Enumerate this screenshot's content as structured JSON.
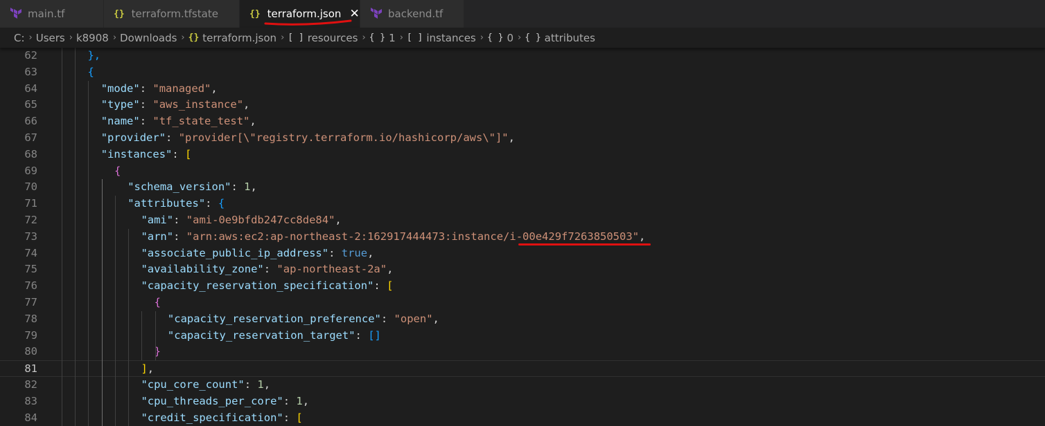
{
  "tabs": [
    {
      "label": "main.tf",
      "icon": "terraform-icon",
      "active": false
    },
    {
      "label": "terraform.tfstate",
      "icon": "json-braces-icon",
      "active": false
    },
    {
      "label": "terraform.json",
      "icon": "json-braces-icon",
      "active": true
    },
    {
      "label": "backend.tf",
      "icon": "terraform-icon",
      "active": false
    }
  ],
  "icon_glyphs": {
    "json_braces": "{}",
    "array_brackets": "[ ]",
    "object_braces": "{ }",
    "close": "✕",
    "chevron": "›"
  },
  "breadcrumb": {
    "drive": "C:",
    "users": "Users",
    "user": "k8908",
    "downloads": "Downloads",
    "file": "terraform.json",
    "resources": "resources",
    "resources_index": "1",
    "instances": "instances",
    "instances_index": "0",
    "attributes": "attributes"
  },
  "colors": {
    "key": "#9cdcfe",
    "string": "#ce9178",
    "number": "#b5cea8",
    "boolean": "#569cd6",
    "bracket_gold": "#ffd700",
    "bracket_orchid": "#da70d6",
    "bracket_blue": "#179fff",
    "annotation": "#e01010",
    "terraform_purple": "#7b42bc",
    "json_yellow": "#cbcb41"
  },
  "editor": {
    "current_line": "81",
    "lines": [
      {
        "n": "62",
        "t": [
          [
            "br3",
            "},"
          ]
        ]
      },
      {
        "n": "63",
        "t": [
          [
            "br3",
            "{"
          ]
        ]
      },
      {
        "n": "64",
        "t": [
          [
            "k",
            "\"mode\""
          ],
          [
            "p",
            ": "
          ],
          [
            "s",
            "\"managed\""
          ],
          [
            "p",
            ","
          ]
        ]
      },
      {
        "n": "65",
        "t": [
          [
            "k",
            "\"type\""
          ],
          [
            "p",
            ": "
          ],
          [
            "s",
            "\"aws_instance\""
          ],
          [
            "p",
            ","
          ]
        ]
      },
      {
        "n": "66",
        "t": [
          [
            "k",
            "\"name\""
          ],
          [
            "p",
            ": "
          ],
          [
            "s",
            "\"tf_state_test\""
          ],
          [
            "p",
            ","
          ]
        ]
      },
      {
        "n": "67",
        "t": [
          [
            "k",
            "\"provider\""
          ],
          [
            "p",
            ": "
          ],
          [
            "s",
            "\"provider[\\\"registry.terraform.io/hashicorp/aws\\\"]\""
          ],
          [
            "p",
            ","
          ]
        ]
      },
      {
        "n": "68",
        "t": [
          [
            "k",
            "\"instances\""
          ],
          [
            "p",
            ": "
          ],
          [
            "br1",
            "["
          ]
        ]
      },
      {
        "n": "69",
        "t": [
          [
            "br2",
            "{"
          ]
        ]
      },
      {
        "n": "70",
        "t": [
          [
            "k",
            "\"schema_version\""
          ],
          [
            "p",
            ": "
          ],
          [
            "n",
            "1"
          ],
          [
            "p",
            ","
          ]
        ]
      },
      {
        "n": "71",
        "t": [
          [
            "k",
            "\"attributes\""
          ],
          [
            "p",
            ": "
          ],
          [
            "br3",
            "{"
          ]
        ]
      },
      {
        "n": "72",
        "t": [
          [
            "k",
            "\"ami\""
          ],
          [
            "p",
            ": "
          ],
          [
            "s",
            "\"ami-0e9bfdb247cc8de84\""
          ],
          [
            "p",
            ","
          ]
        ]
      },
      {
        "n": "73",
        "t": [
          [
            "k",
            "\"arn\""
          ],
          [
            "p",
            ": "
          ],
          [
            "s",
            "\"arn:aws:ec2:ap-northeast-2:162917444473:instance/"
          ],
          [
            "s",
            "i-00e429f7263850503"
          ],
          [
            "s",
            "\""
          ],
          [
            "p",
            ","
          ]
        ]
      },
      {
        "n": "74",
        "t": [
          [
            "k",
            "\"associate_public_ip_address\""
          ],
          [
            "p",
            ": "
          ],
          [
            "b",
            "true"
          ],
          [
            "p",
            ","
          ]
        ]
      },
      {
        "n": "75",
        "t": [
          [
            "k",
            "\"availability_zone\""
          ],
          [
            "p",
            ": "
          ],
          [
            "s",
            "\"ap-northeast-2a\""
          ],
          [
            "p",
            ","
          ]
        ]
      },
      {
        "n": "76",
        "t": [
          [
            "k",
            "\"capacity_reservation_specification\""
          ],
          [
            "p",
            ": "
          ],
          [
            "br1",
            "["
          ]
        ]
      },
      {
        "n": "77",
        "t": [
          [
            "br2",
            "{"
          ]
        ]
      },
      {
        "n": "78",
        "t": [
          [
            "k",
            "\"capacity_reservation_preference\""
          ],
          [
            "p",
            ": "
          ],
          [
            "s",
            "\"open\""
          ],
          [
            "p",
            ","
          ]
        ]
      },
      {
        "n": "79",
        "t": [
          [
            "k",
            "\"capacity_reservation_target\""
          ],
          [
            "p",
            ": "
          ],
          [
            "br3",
            "[]"
          ]
        ]
      },
      {
        "n": "80",
        "t": [
          [
            "br2",
            "}"
          ]
        ]
      },
      {
        "n": "81",
        "t": [
          [
            "br1",
            "]"
          ],
          [
            "p",
            ","
          ]
        ]
      },
      {
        "n": "82",
        "t": [
          [
            "k",
            "\"cpu_core_count\""
          ],
          [
            "p",
            ": "
          ],
          [
            "n",
            "1"
          ],
          [
            "p",
            ","
          ]
        ]
      },
      {
        "n": "83",
        "t": [
          [
            "k",
            "\"cpu_threads_per_core\""
          ],
          [
            "p",
            ": "
          ],
          [
            "n",
            "1"
          ],
          [
            "p",
            ","
          ]
        ]
      },
      {
        "n": "84",
        "t": [
          [
            "k",
            "\"credit_specification\""
          ],
          [
            "p",
            ": "
          ],
          [
            "br1",
            "["
          ]
        ]
      }
    ]
  }
}
